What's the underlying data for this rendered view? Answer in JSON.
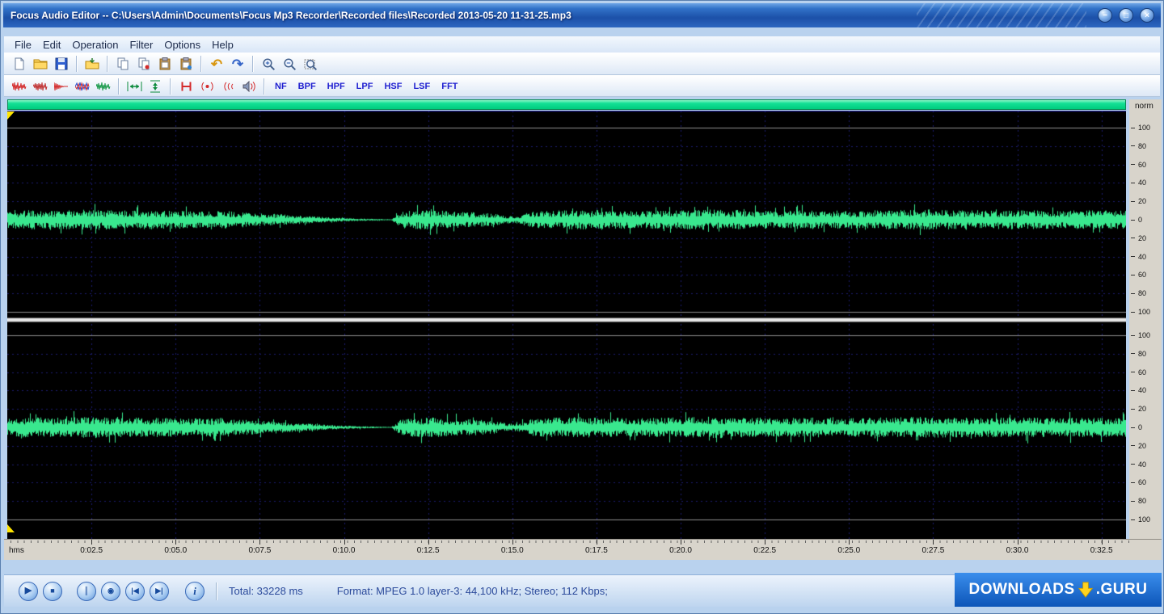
{
  "window": {
    "title": "Focus Audio Editor -- C:\\Users\\Admin\\Documents\\Focus Mp3 Recorder\\Recorded files\\Recorded 2013-05-20 11-31-25.mp3",
    "controls": {
      "minimize": "−",
      "maximize": "□",
      "close": "×"
    }
  },
  "menu": {
    "items": [
      "File",
      "Edit",
      "Operation",
      "Filter",
      "Options",
      "Help"
    ]
  },
  "toolbar1": {
    "tools": [
      "new-file",
      "open-file",
      "save-file",
      "import-file",
      "copy",
      "copy-special",
      "paste",
      "paste-special",
      "undo",
      "redo",
      "zoom-in",
      "zoom-out",
      "zoom-selection"
    ],
    "undo_glyph": "↶",
    "redo_glyph": "↷"
  },
  "toolbar2": {
    "tools": [
      "waveform-tool-1",
      "waveform-tool-2",
      "waveform-tool-3",
      "waveform-tool-4",
      "waveform-tool-5",
      "fit-horizontal",
      "fit-vertical",
      "mix",
      "echo",
      "vibrato",
      "preview"
    ],
    "filters": [
      "NF",
      "BPF",
      "HPF",
      "LPF",
      "HSF",
      "LSF",
      "FFT"
    ]
  },
  "scale": {
    "norm_label": "norm",
    "ticks": [
      "100",
      "80",
      "60",
      "40",
      "20",
      "0",
      "20",
      "40",
      "60",
      "80",
      "100"
    ]
  },
  "timeline": {
    "unit_label": "hms",
    "tick_interval_s": 2.5,
    "ticks": [
      "0:02.5",
      "0:05.0",
      "0:07.5",
      "0:10.0",
      "0:12.5",
      "0:15.0",
      "0:17.5",
      "0:20.0",
      "0:22.5",
      "0:25.0",
      "0:27.5",
      "0:30.0",
      "0:32.5"
    ]
  },
  "transport": {
    "play": "▶",
    "stop": "■",
    "pause": "║",
    "speed": "◉",
    "previous": "|◀",
    "next": "▶|",
    "info": "i"
  },
  "status": {
    "total": "Total: 33228 ms",
    "format": "Format: MPEG 1.0 layer-3: 44,100 kHz; Stereo; 112 Kbps;"
  },
  "watermark": {
    "left": "DOWNLOADS",
    "right": ".GURU"
  },
  "waveform": {
    "color": "#39e88e",
    "background": "#000000",
    "grid_color": "#1d1d72",
    "duration_s": 33.228,
    "channels": 2,
    "envelope": [
      [
        0,
        0.07
      ],
      [
        0.5,
        0.085
      ],
      [
        1.5,
        0.08
      ],
      [
        2.5,
        0.09
      ],
      [
        3.5,
        0.08
      ],
      [
        4.5,
        0.082
      ],
      [
        5.5,
        0.075
      ],
      [
        6.5,
        0.08
      ],
      [
        7,
        0.065
      ],
      [
        7.5,
        0.056
      ],
      [
        8,
        0.05
      ],
      [
        8.5,
        0.04
      ],
      [
        9,
        0.03
      ],
      [
        9.5,
        0.022
      ],
      [
        10,
        0.015
      ],
      [
        10.5,
        0.01
      ],
      [
        11,
        0.006
      ],
      [
        11.4,
        0.004
      ],
      [
        11.55,
        0.04
      ],
      [
        11.7,
        0.075
      ],
      [
        12.5,
        0.085
      ],
      [
        13,
        0.076
      ],
      [
        13.5,
        0.07
      ],
      [
        14,
        0.064
      ],
      [
        14.5,
        0.05
      ],
      [
        14.9,
        0.033
      ],
      [
        15.2,
        0.036
      ],
      [
        15.5,
        0.07
      ],
      [
        16,
        0.08
      ],
      [
        17,
        0.086
      ],
      [
        18,
        0.08
      ],
      [
        19,
        0.078
      ],
      [
        20,
        0.083
      ],
      [
        21,
        0.09
      ],
      [
        22,
        0.082
      ],
      [
        23,
        0.078
      ],
      [
        24,
        0.083
      ],
      [
        25,
        0.08
      ],
      [
        26,
        0.082
      ],
      [
        27,
        0.088
      ],
      [
        28,
        0.084
      ],
      [
        29,
        0.08
      ],
      [
        30,
        0.084
      ],
      [
        31,
        0.079
      ],
      [
        32,
        0.083
      ],
      [
        33.23,
        0.081
      ]
    ]
  }
}
